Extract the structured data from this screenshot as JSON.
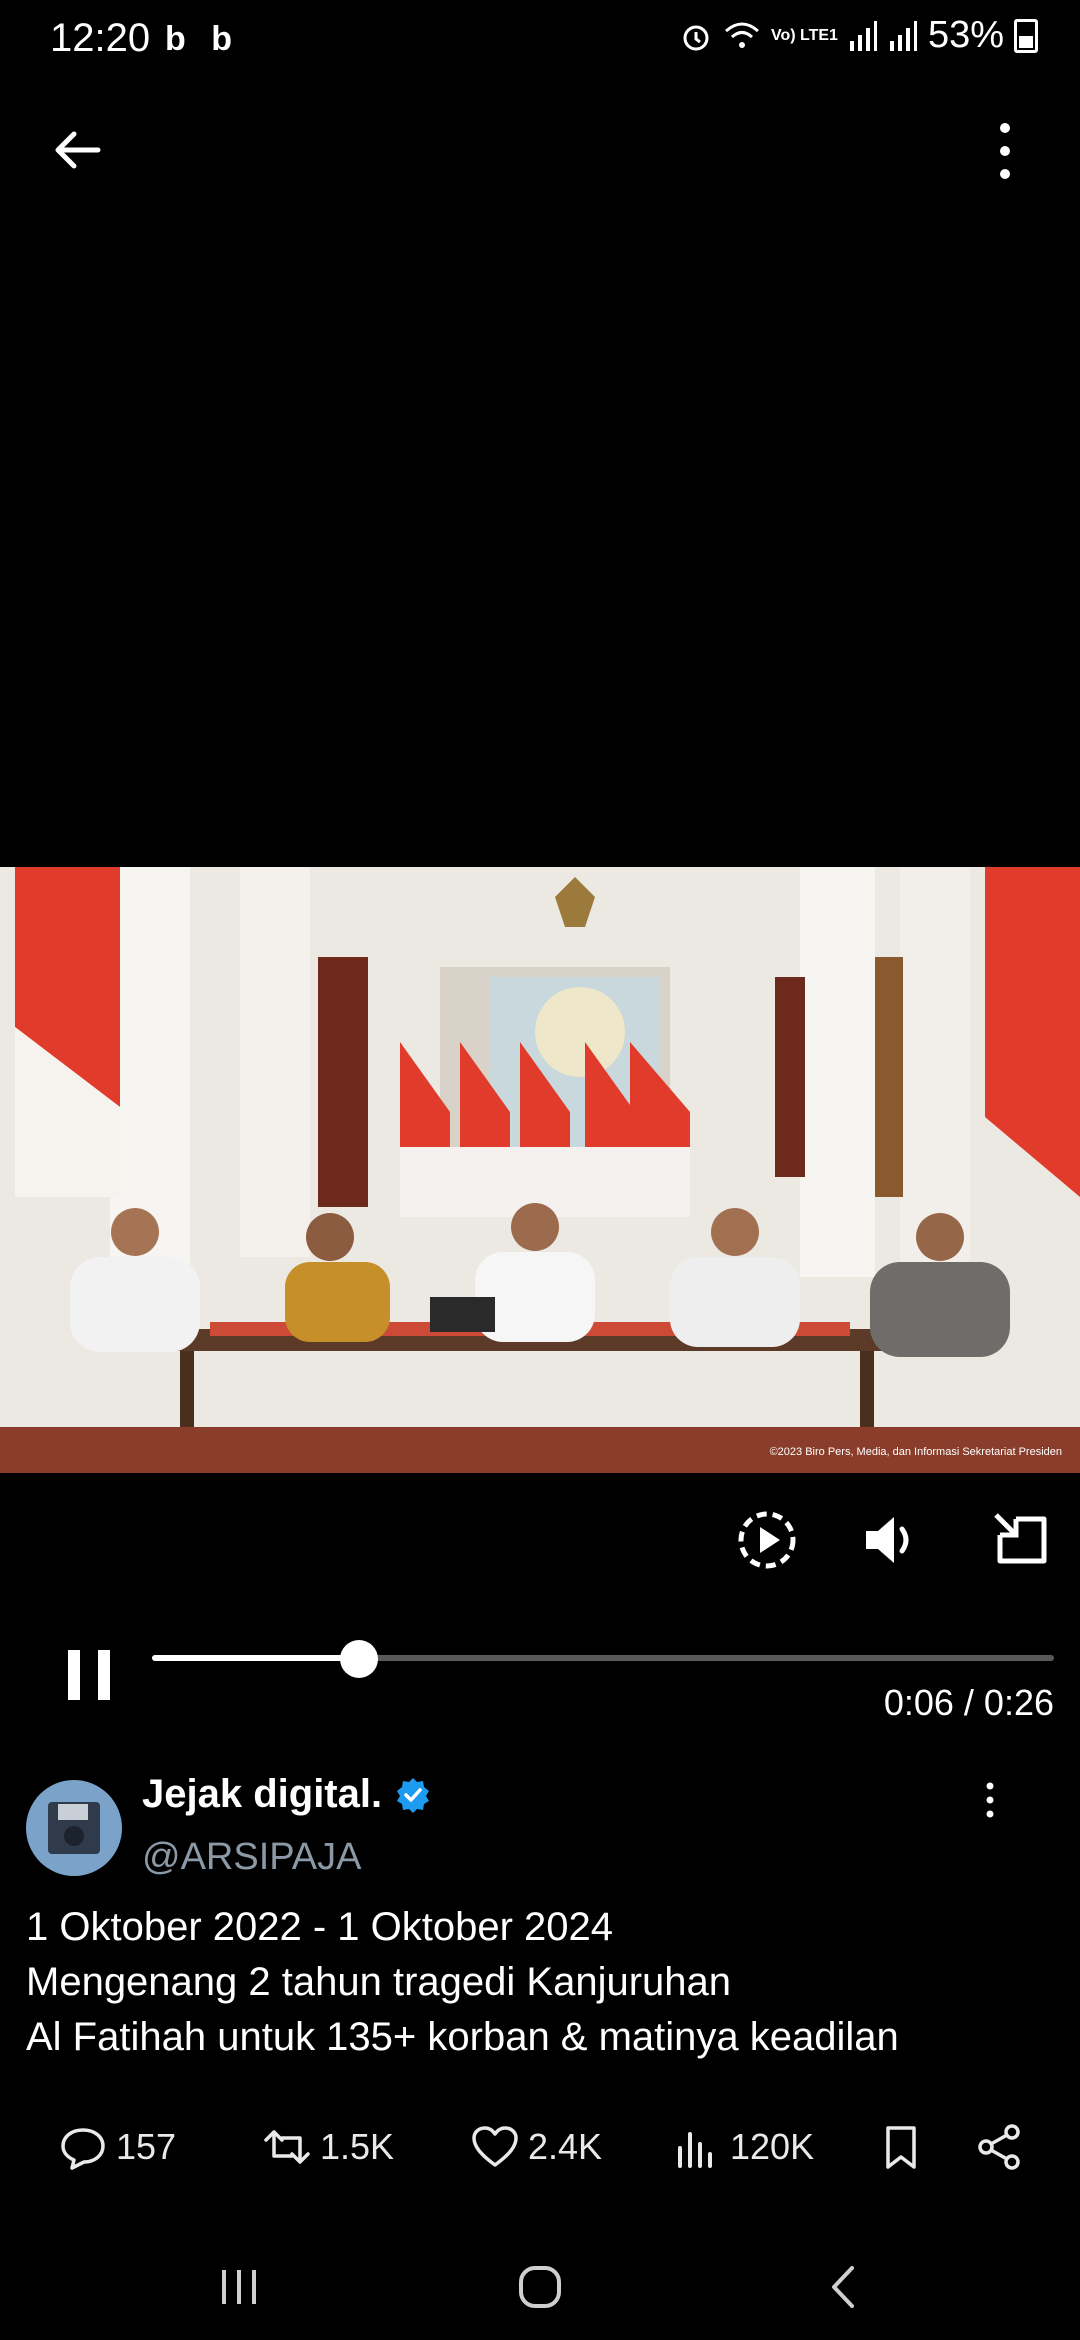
{
  "status_bar": {
    "time": "12:20",
    "left_icons": "b b",
    "network": "Vo) LTE1",
    "battery": "53%"
  },
  "video": {
    "watermark": "©2023 Biro Pers, Media, dan Informasi Sekretariat Presiden",
    "progress_fraction": 0.23,
    "time_current": "0:06",
    "time_total": "0:26",
    "timecode": "0:06 / 0:26"
  },
  "tweet": {
    "display_name": "Jejak digital.",
    "handle": "@ARSIPAJA",
    "lines": [
      "1 Oktober 2022 - 1 Oktober 2024",
      "Mengenang 2 tahun tragedi Kanjuruhan",
      "Al Fatihah untuk 135+ korban & matinya keadilan"
    ]
  },
  "actions": {
    "replies": "157",
    "reposts": "1.5K",
    "likes": "2.4K",
    "views": "120K"
  },
  "colors": {
    "background": "#000000",
    "verified": "#1d9bf0",
    "handle": "#8b98a5"
  }
}
